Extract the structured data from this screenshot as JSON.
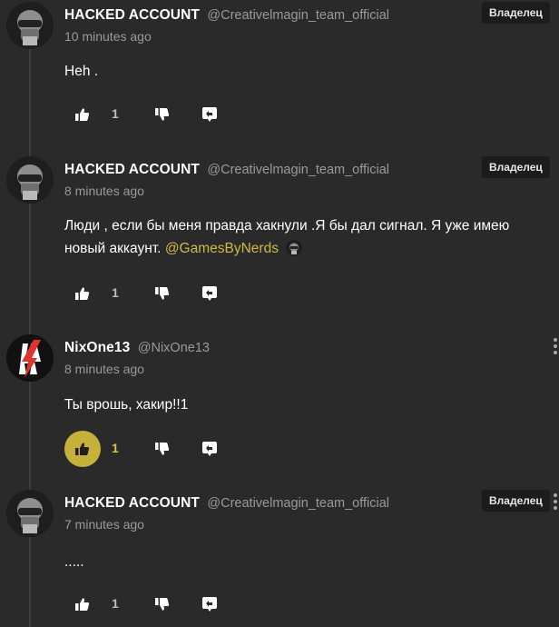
{
  "comments": [
    {
      "name": "HACKED ACCOUNT",
      "handle": "@Creativelmagin_team_official",
      "time": "10 minutes ago",
      "badge": "Владелец",
      "text": "Heh .",
      "likes": "1",
      "avatar": "helmet-avatar",
      "liked": false
    },
    {
      "name": "HACKED ACCOUNT",
      "handle": "@Creativelmagin_team_official",
      "time": "8 minutes ago",
      "badge": "Владелец",
      "text_line1": "Люди , если бы меня правда хакнули .Я бы дал сигнал.  Я уже имею",
      "text_line2": "новый аккаунт.",
      "mention": "@GamesByNerds",
      "likes": "1",
      "avatar": "helmet-avatar",
      "liked": false
    },
    {
      "name": "NixOne13",
      "handle": "@NixOne13",
      "time": "8 minutes ago",
      "text": "Ты врошь, хакир!!1",
      "likes": "1",
      "avatar": "lightning-avatar",
      "liked": true,
      "accent": "#c6b23b"
    },
    {
      "name": "HACKED ACCOUNT",
      "handle": "@Creativelmagin_team_official",
      "time": "7 minutes ago",
      "badge": "Владелец",
      "text": ".....",
      "likes": "1",
      "avatar": "helmet-avatar",
      "liked": false
    }
  ],
  "icons": {
    "like": "thumbs-up-icon",
    "dislike": "thumbs-down-icon",
    "reply": "reply-icon",
    "menu": "more-vertical-icon"
  }
}
